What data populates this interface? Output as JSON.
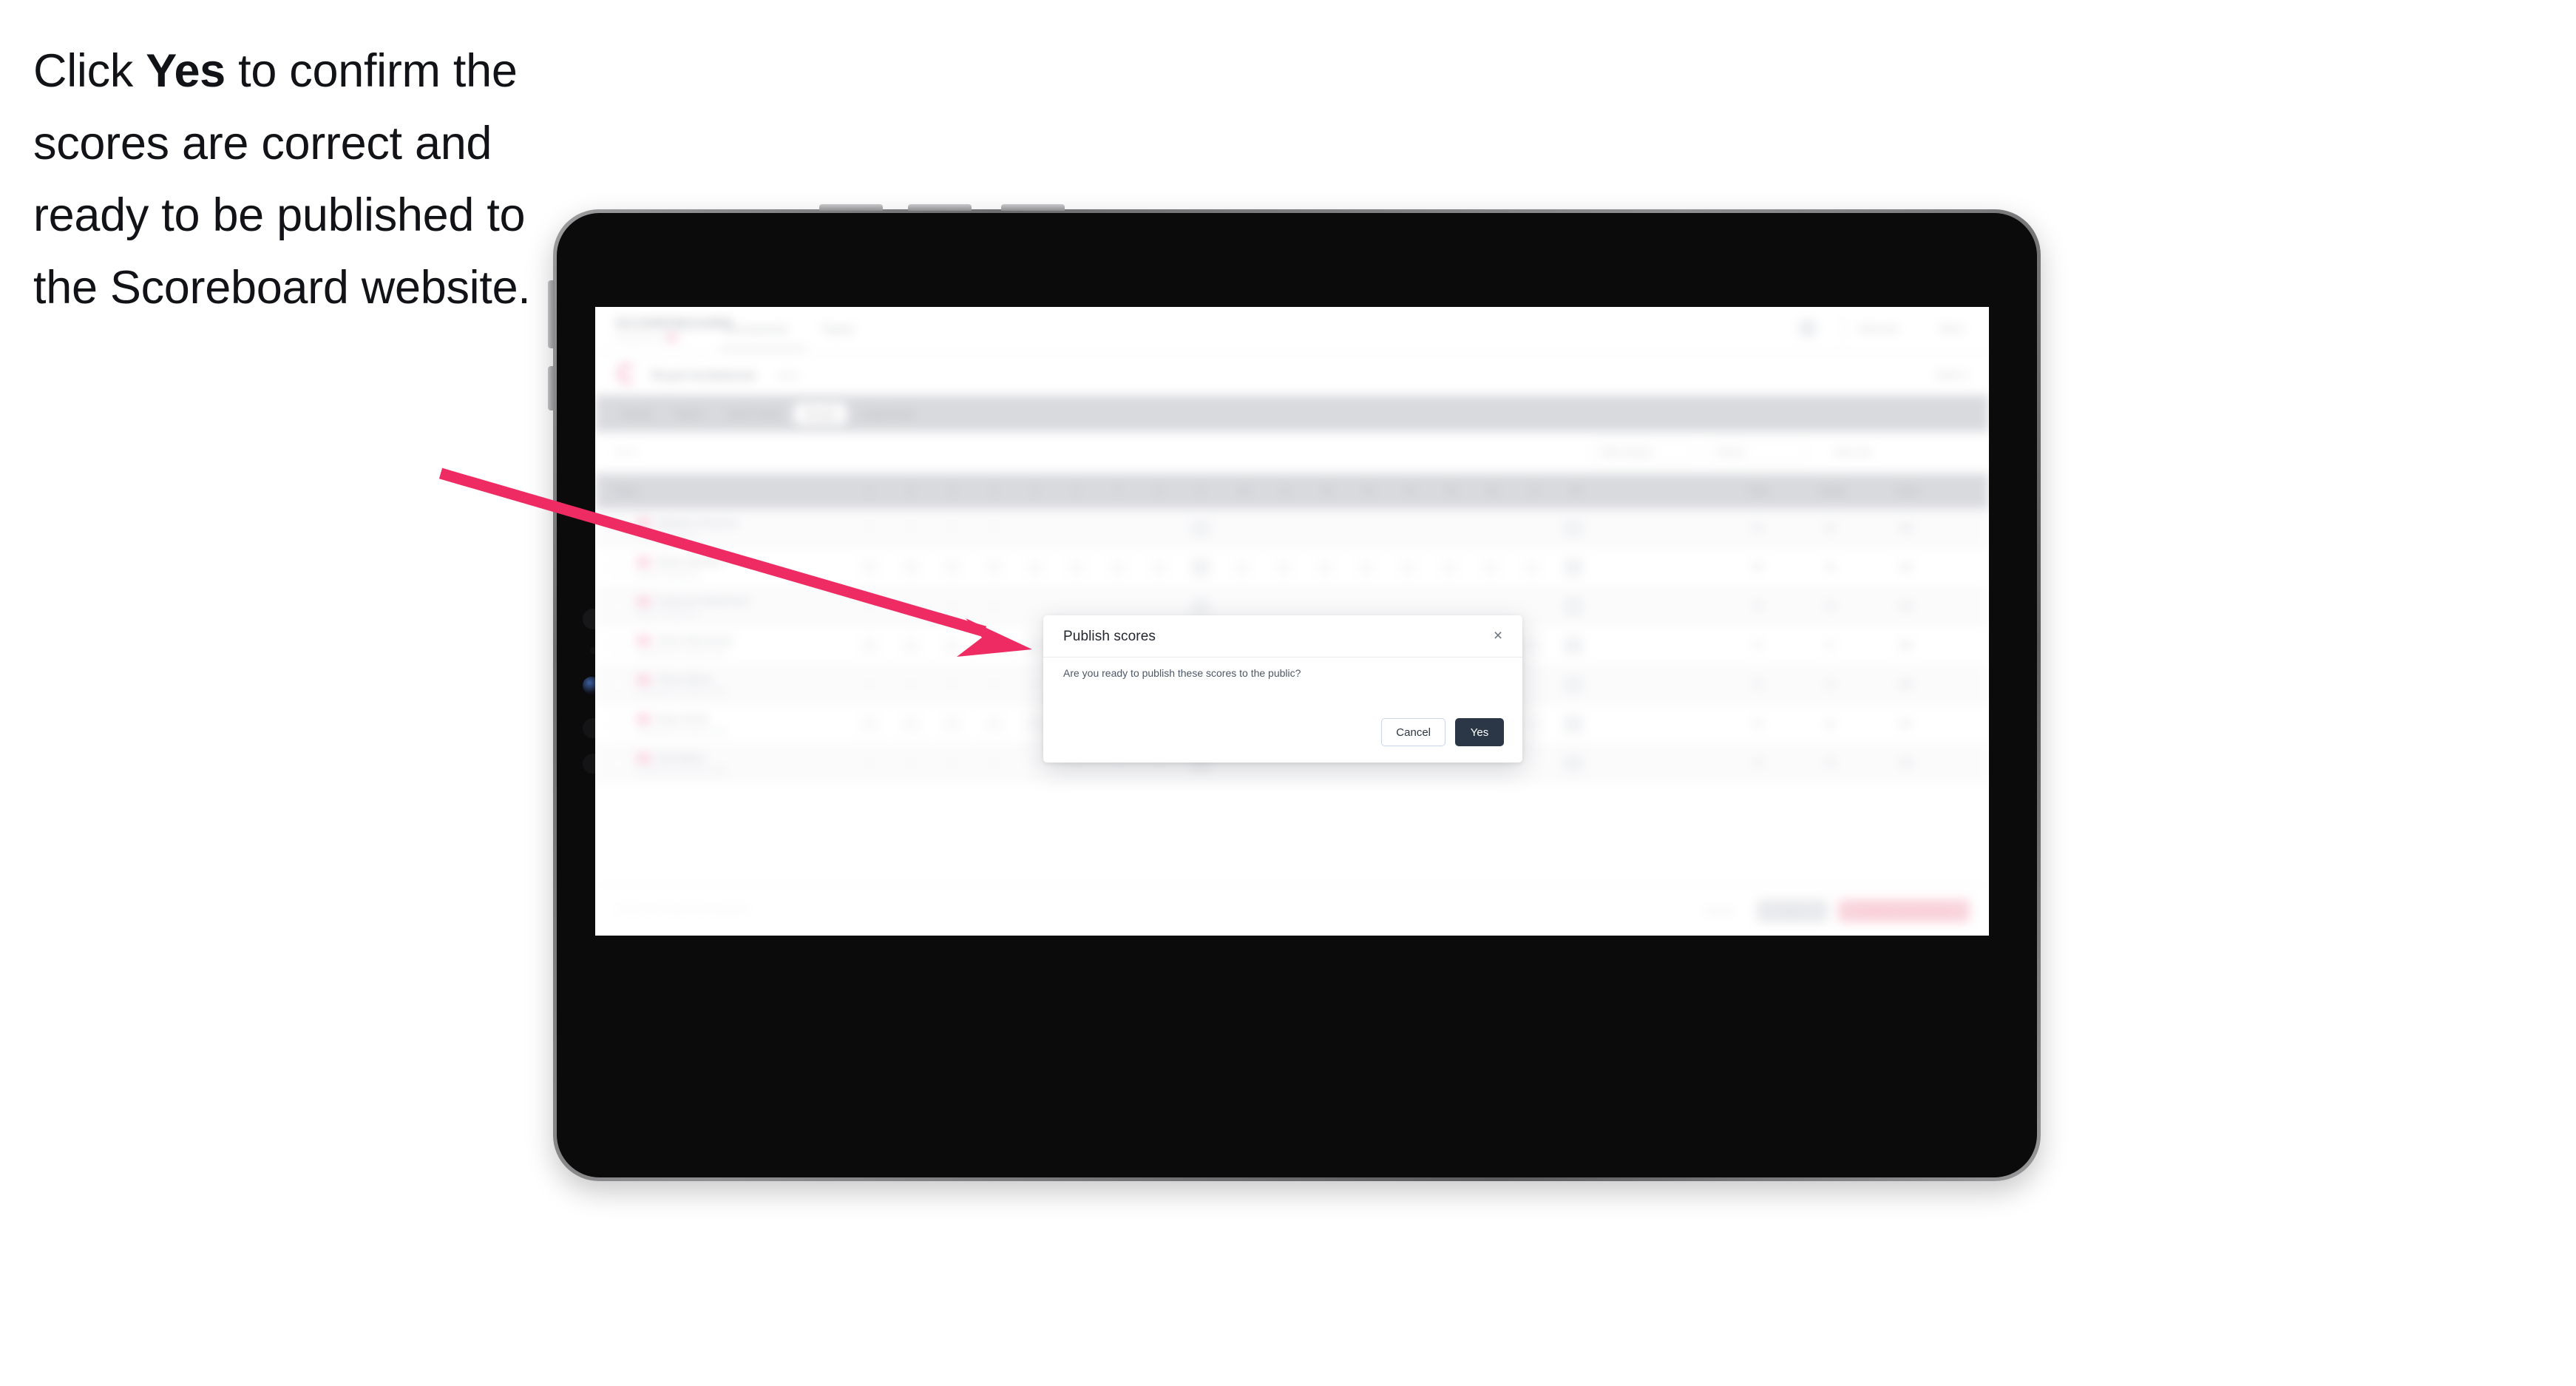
{
  "annotation": {
    "text_parts": [
      "Click ",
      "Yes",
      " to confirm the scores are correct and ready to be published to the Scoreboard website."
    ],
    "plain_text": "Click Yes to confirm the scores are correct and ready to be published to the Scoreboard website.",
    "arrow_color": "#EE2B63"
  },
  "app": {
    "brand": "SCOREBOARD",
    "brand_sub": "POWERED BY",
    "nav": [
      "Tournaments",
      "Teams"
    ],
    "header_right": [
      "Welcome",
      "Menu"
    ],
    "club": {
      "name": "Royal Invitational",
      "year": "2024",
      "right_meta": "Week 3"
    },
    "tabs": [
      {
        "label": "Details",
        "active": false
      },
      {
        "label": "Teams",
        "active": false
      },
      {
        "label": "Game Sheet",
        "active": false
      },
      {
        "label": "Results",
        "active": true
      },
      {
        "label": "Leaderboard",
        "active": false
      }
    ],
    "filters": {
      "left_label": "Filters",
      "pill_1": "Filter division",
      "pill_2": "Round",
      "pill_3": "Team info"
    },
    "table": {
      "headers": [
        "Player",
        "1",
        "2",
        "3",
        "4",
        "5",
        "6",
        "7",
        "8",
        "9",
        "10",
        "11",
        "12",
        "13",
        "14",
        "15",
        "16",
        "17",
        "18",
        "Total",
        "Played",
        "Score"
      ],
      "rows": [
        {
          "name": "Matthew Simpson",
          "sub": "Royal Invitational",
          "cells": [
            "4",
            "4",
            "3",
            "4",
            "",
            "",
            "",
            "",
            "",
            "",
            "",
            "",
            "",
            "",
            "",
            "",
            "",
            ""
          ],
          "total": "68",
          "played": "18",
          "score": "140"
        },
        {
          "name": "Ethan Randall",
          "sub": "Royal Invitational",
          "cells": [
            "4",
            "5",
            "4",
            "4",
            "",
            "",
            "",
            "",
            "",
            "",
            "",
            "",
            "",
            "",
            "",
            "",
            "",
            ""
          ],
          "total": "69",
          "played": "18",
          "score": "142"
        },
        {
          "name": "Cameron Robertson",
          "sub": "Royal Invitational",
          "cells": [
            "4",
            "4",
            "4",
            "4",
            "",
            "",
            "",
            "",
            "",
            "",
            "",
            "",
            "",
            "",
            "",
            "",
            "",
            ""
          ],
          "total": "70",
          "played": "18",
          "score": "143"
        },
        {
          "name": "Chris Stevenson",
          "sub": "Northwood Country Club",
          "cells": [
            "5",
            "4",
            "4",
            "4",
            "4",
            "5",
            "4",
            "4",
            "",
            "",
            "",
            "",
            "",
            "",
            "",
            "",
            "",
            ""
          ],
          "total": "71",
          "played": "17",
          "score": "145"
        },
        {
          "name": "Oliver Blunt",
          "sub": "Northwood Country Club",
          "cells": [
            "4",
            "4",
            "5",
            "4",
            "4",
            "4",
            "5",
            "4",
            "",
            "",
            "",
            "",
            "",
            "",
            "",
            "",
            "",
            ""
          ],
          "total": "72",
          "played": "17",
          "score": "146"
        },
        {
          "name": "Ryan Scott",
          "sub": "Northwood Country Club",
          "cells": [
            "4",
            "5",
            "4",
            "5",
            "4",
            "4",
            "4",
            "4",
            "",
            "",
            "",
            "",
            "",
            "",
            "",
            "",
            "",
            ""
          ],
          "total": "73",
          "played": "16",
          "score": "147"
        },
        {
          "name": "Rob Baker",
          "sub": "Northwood Country Club",
          "cells": [
            "5",
            "4",
            "4",
            "4",
            "5",
            "4",
            "4",
            "5",
            "",
            "",
            "",
            "",
            "",
            "",
            "",
            "",
            "",
            ""
          ],
          "total": "74",
          "played": "16",
          "score": "149"
        }
      ]
    },
    "footer": {
      "note": "Scores are locked once published",
      "ghost_button": "Cancel",
      "gray_button": "Save",
      "pink_button": "Publish to Scoreboard"
    }
  },
  "modal": {
    "title": "Publish scores",
    "body": "Are you ready to publish these scores to the public?",
    "close_icon": "×",
    "cancel_label": "Cancel",
    "yes_label": "Yes",
    "yes_bg": "#2B3646"
  }
}
